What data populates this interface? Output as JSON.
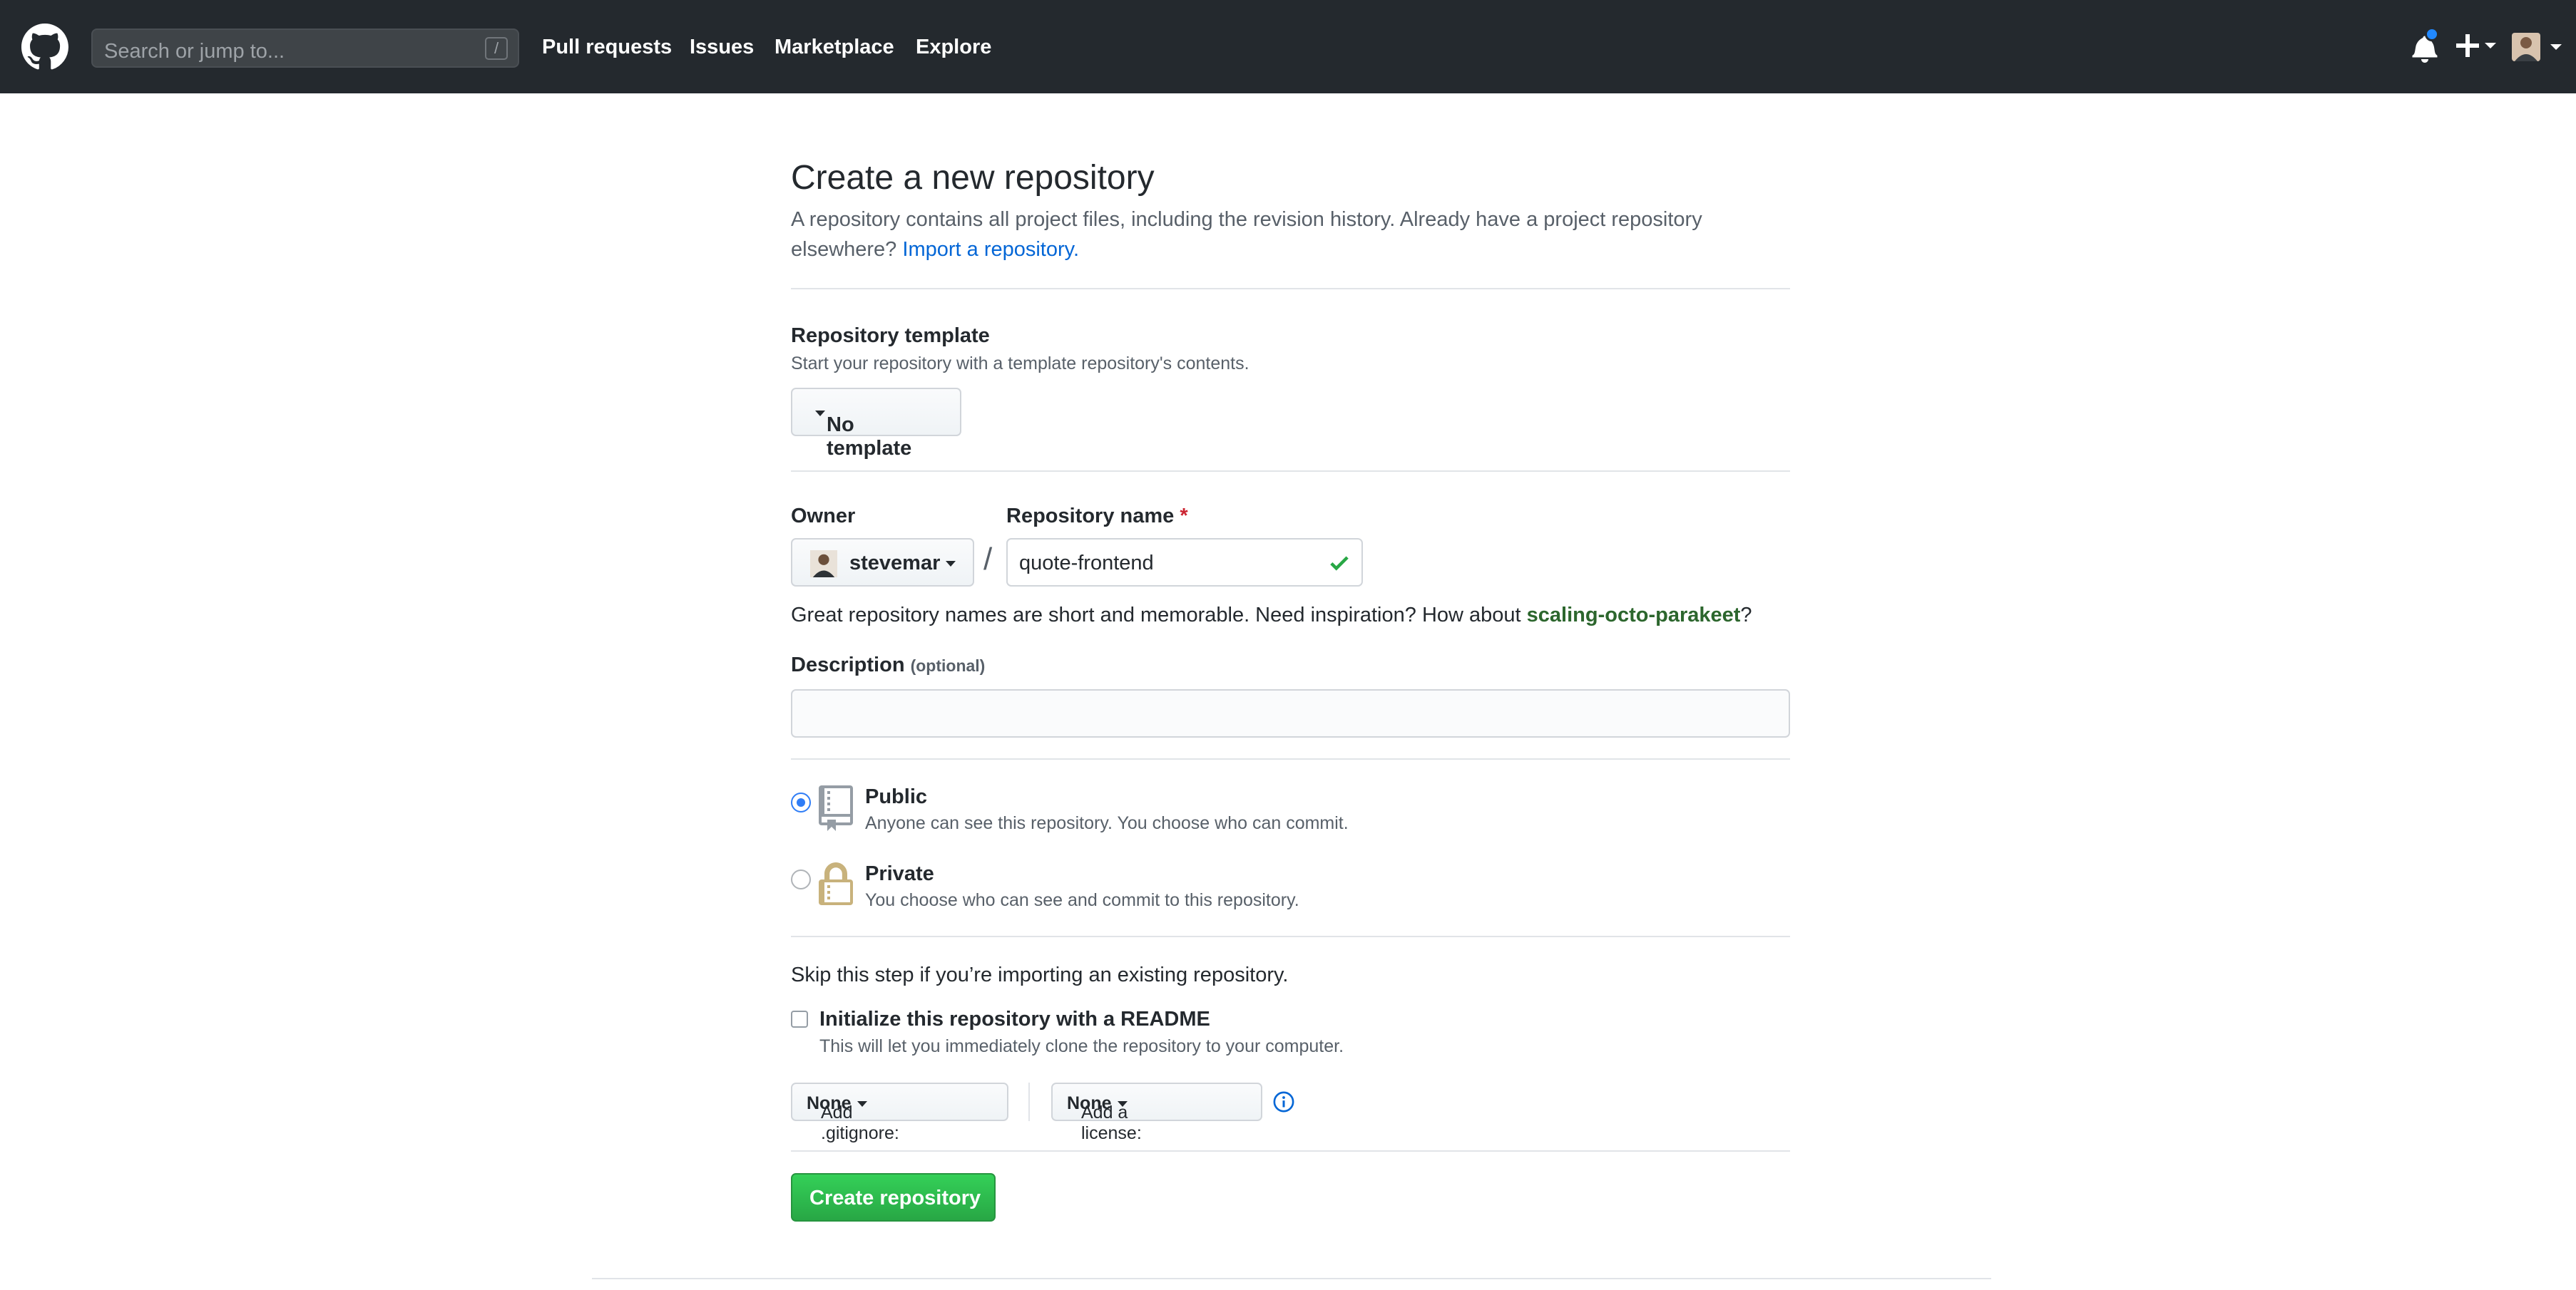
{
  "header": {
    "search_placeholder": "Search or jump to...",
    "search_key": "/",
    "nav": [
      "Pull requests",
      "Issues",
      "Marketplace",
      "Explore"
    ],
    "icons": [
      "github-logo-icon",
      "bell-icon",
      "plus-icon",
      "avatar"
    ],
    "notification_dot_color": "#2188ff"
  },
  "main": {
    "title": "Create a new repository",
    "subtitle_text": "A repository contains all project files, including the revision history. Already have a project repository elsewhere?",
    "import_link": "Import a repository.",
    "template": {
      "label": "Repository template",
      "note": "Start your repository with a template repository's contents.",
      "button": "No template"
    },
    "owner": {
      "label": "Owner",
      "value": "stevemar"
    },
    "repo_name": {
      "label": "Repository name",
      "required_mark": "*",
      "value": "quote-frontend",
      "valid": true
    },
    "hint": {
      "prefix": "Great repository names are short and memorable. Need inspiration? How about",
      "suggestion": "scaling-octo-parakeet",
      "suffix": "?"
    },
    "description": {
      "label": "Description",
      "optional": "(optional)",
      "value": ""
    },
    "visibility": {
      "selected": "public",
      "public": {
        "title": "Public",
        "desc": "Anyone can see this repository. You choose who can commit."
      },
      "private": {
        "title": "Private",
        "desc": "You choose who can see and commit to this repository."
      }
    },
    "init": {
      "skip_text": "Skip this step if you’re importing an existing repository.",
      "readme_label": "Initialize this repository with a README",
      "readme_desc": "This will let you immediately clone the repository to your computer.",
      "readme_checked": false,
      "gitignore_label": "Add .gitignore:",
      "gitignore_value": "None",
      "license_label": "Add a license:",
      "license_value": "None"
    },
    "create_button": "Create repository",
    "colors": {
      "link": "#0366d6",
      "create_button": "#28a745",
      "suggestion": "#2c662d",
      "selected_radio": "#2f7df6"
    }
  }
}
